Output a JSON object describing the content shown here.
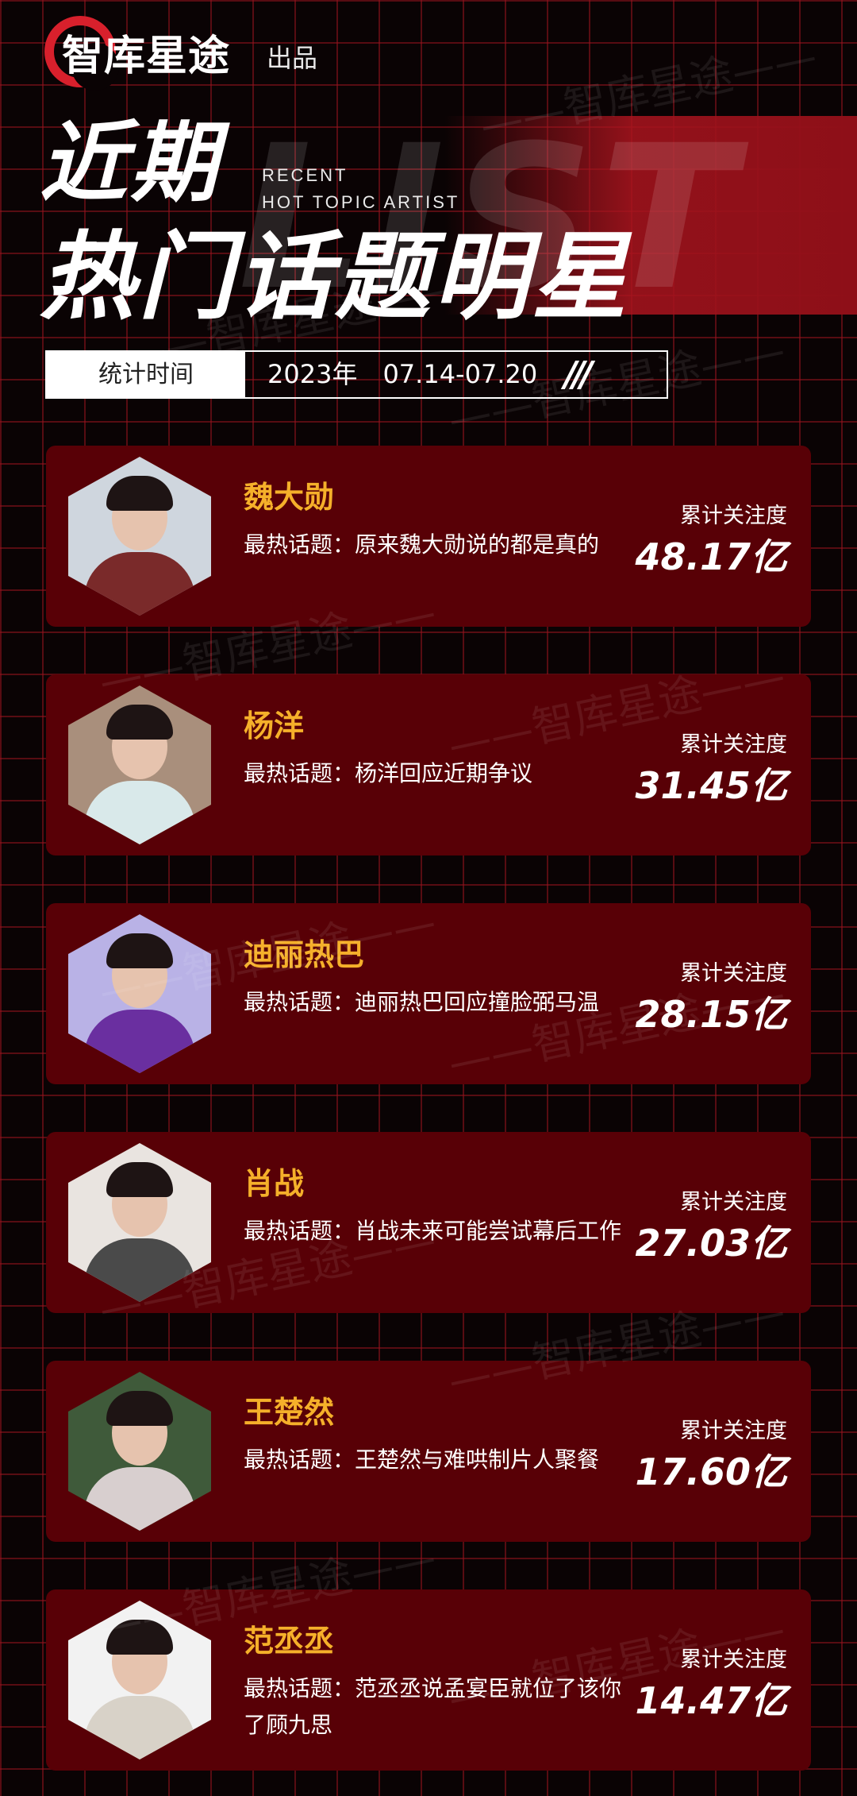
{
  "brand": {
    "logo_text": "智库星途",
    "produced_by": "出品",
    "watermark": "——智库星途——"
  },
  "title": {
    "line1": "近期",
    "line2": "热门话题明星",
    "en_line1": "RECENT",
    "en_line2": "HOT TOPIC ARTIST",
    "background_word": "LIST"
  },
  "stat": {
    "label": "统计时间",
    "value": "2023年　07.14-07.20",
    "decoration": "///"
  },
  "colors": {
    "card": "#580006",
    "name": "#f5b02a",
    "grid": "#96141e",
    "accent": "#d8202c"
  },
  "cards": [
    {
      "name": "魏大勋",
      "topic": "最热话题：原来魏大勋说的都是真的",
      "attention_label": "累计关注度",
      "attention": "48.17亿"
    },
    {
      "name": "杨洋",
      "topic": "最热话题：杨洋回应近期争议",
      "attention_label": "累计关注度",
      "attention": "31.45亿"
    },
    {
      "name": "迪丽热巴",
      "topic": "最热话题：迪丽热巴回应撞脸弼马温",
      "attention_label": "累计关注度",
      "attention": "28.15亿"
    },
    {
      "name": "肖战",
      "topic": "最热话题：肖战未来可能尝试幕后工作",
      "attention_label": "累计关注度",
      "attention": "27.03亿"
    },
    {
      "name": "王楚然",
      "topic": "最热话题：王楚然与难哄制片人聚餐",
      "attention_label": "累计关注度",
      "attention": "17.60亿"
    },
    {
      "name": "范丞丞",
      "topic": "最热话题：范丞丞说孟宴臣就位了该你了顾九思",
      "attention_label": "累计关注度",
      "attention": "14.47亿"
    }
  ]
}
